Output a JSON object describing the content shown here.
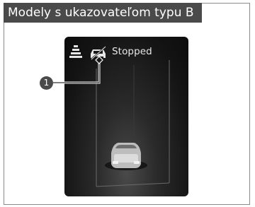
{
  "header": {
    "title": "Modely s ukazovateľom typu B"
  },
  "display": {
    "status_text": "Stopped"
  },
  "callout": {
    "number": "1"
  },
  "icons": [
    "lane-watch-icon",
    "vehicle-ahead-icon",
    "subject-car-icon"
  ],
  "colors": {
    "header_bg": "#4a4a4a",
    "display_bg": "#141414",
    "callout_bg": "#4a4a4a"
  }
}
